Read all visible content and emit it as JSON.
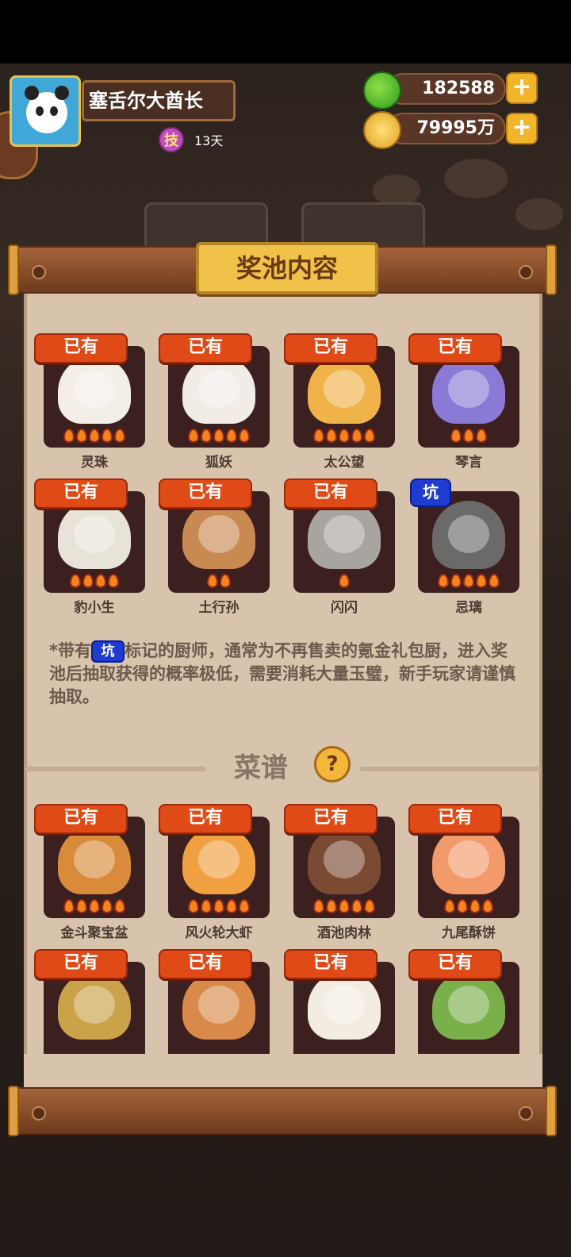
{
  "player": {
    "name": "塞舌尔大酋长",
    "skill_badge": "技",
    "days": "13天"
  },
  "resources": [
    {
      "icon": "jade-apple-icon",
      "value": "182588",
      "plus": "+"
    },
    {
      "icon": "coin-icon",
      "value": "79995万",
      "plus": "+"
    }
  ],
  "panel": {
    "title": "奖池内容",
    "owned_label": "已有",
    "pit_label": "坑",
    "note_prefix": "*带有",
    "note_suffix": "标记的厨师，通常为不再售卖的氪金礼包厨，进入奖池后抽取获得的概率极低，需要消耗大量玉璧，新手玩家请谨慎抽取。",
    "recipes_title": "菜谱",
    "help_icon": "?"
  },
  "chefs": [
    {
      "name": "灵珠",
      "tag": "owned",
      "stars": 5,
      "color": "#f3efe6"
    },
    {
      "name": "狐妖",
      "tag": "owned",
      "stars": 5,
      "color": "#f1ece6"
    },
    {
      "name": "太公望",
      "tag": "owned",
      "stars": 5,
      "color": "#f0b34a"
    },
    {
      "name": "琴言",
      "tag": "owned",
      "stars": 3,
      "color": "#8a7ad6"
    },
    {
      "name": "豹小生",
      "tag": "owned",
      "stars": 4,
      "color": "#e7e3d8"
    },
    {
      "name": "土行孙",
      "tag": "owned",
      "stars": 2,
      "color": "#c98a52"
    },
    {
      "name": "闪闪",
      "tag": "owned",
      "stars": 1,
      "color": "#a8a4a0"
    },
    {
      "name": "忌璃",
      "tag": "pit",
      "stars": 5,
      "color": "#6a6a68"
    }
  ],
  "recipes": [
    {
      "name": "金斗聚宝盆",
      "tag": "owned",
      "stars": 5,
      "color": "#d98a3a"
    },
    {
      "name": "风火轮大虾",
      "tag": "owned",
      "stars": 5,
      "color": "#f0a040"
    },
    {
      "name": "酒池肉林",
      "tag": "owned",
      "stars": 5,
      "color": "#7a4a32"
    },
    {
      "name": "九尾酥饼",
      "tag": "owned",
      "stars": 4,
      "color": "#f29a6a"
    },
    {
      "name": "",
      "tag": "owned",
      "stars": 0,
      "color": "#c9a24a"
    },
    {
      "name": "",
      "tag": "owned",
      "stars": 0,
      "color": "#d98a4a"
    },
    {
      "name": "",
      "tag": "owned",
      "stars": 0,
      "color": "#f3ece0"
    },
    {
      "name": "",
      "tag": "owned",
      "stars": 0,
      "color": "#7ab04a"
    }
  ]
}
